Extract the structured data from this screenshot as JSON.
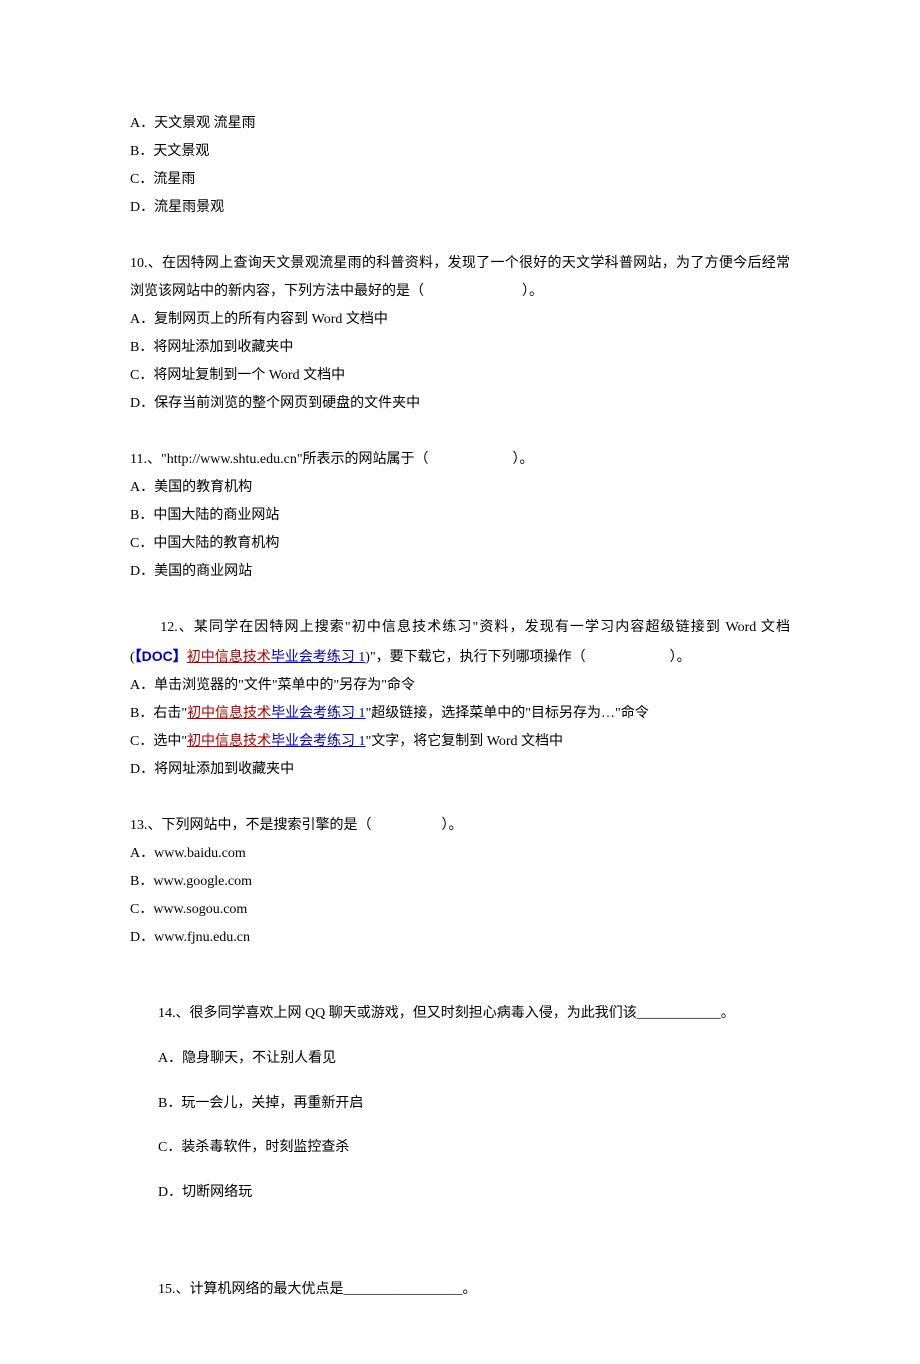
{
  "q9": {
    "optA": "A．天文景观  流星雨",
    "optB": "B．天文景观",
    "optC": "C．流星雨",
    "optD": "D．流星雨景观"
  },
  "q10": {
    "stem": "10.、在因特网上查询天文景观流星雨的科普资料，发现了一个很好的天文学科普网站，为了方便今后经常浏览该网站中的新内容，下列方法中最好的是（　　　　　　　）。",
    "optA": "A．复制网页上的所有内容到 Word 文档中",
    "optB": "B．将网址添加到收藏夹中",
    "optC": "C．将网址复制到一个 Word 文档中",
    "optD": "D．保存当前浏览的整个网页到硬盘的文件夹中"
  },
  "q11": {
    "stem": "11.、\"http://www.shtu.edu.cn\"所表示的网站属于（　　　　　　）。",
    "optA": "A．美国的教育机构",
    "optB": "B．中国大陆的商业网站",
    "optC": "C．中国大陆的教育机构",
    "optD": "D．美国的商业网站"
  },
  "q12": {
    "stem_prefix": "　　12.、某同学在因特网上搜索\"初中信息技术练习\"资料，发现有一学习内容超级链接到 Word 文档(",
    "doc_tag_open": "【",
    "doc_tag_text": "DOC",
    "doc_tag_close": "】",
    "link1_red": "初中信息技术",
    "link1_blue": "毕业会考练习 1",
    "stem_suffix": ")\"，要下载它，执行下列哪项操作（　　　　　　）。",
    "optA": "A．单击浏览器的\"文件\"菜单中的\"另存为\"命令",
    "optB_prefix": "B．右击\"",
    "optB_red": "初中信息技术",
    "optB_blue": "毕业会考练习 1",
    "optB_suffix": "\"超级链接，选择菜单中的\"目标另存为…\"命令",
    "optC_prefix": "C．选中\"",
    "optC_red": "初中信息技术",
    "optC_blue": "毕业会考练习 1",
    "optC_suffix": "\"文字，将它复制到 Word 文档中",
    "optD": "D．将网址添加到收藏夹中"
  },
  "q13": {
    "stem": "13.、下列网站中，不是搜索引擎的是（　　　　　）。",
    "optA": "A．www.baidu.com",
    "optB": "B．www.google.com",
    "optC": "C．www.sogou.com",
    "optD": "D．www.fjnu.edu.cn"
  },
  "q14": {
    "stem": "　　14.、很多同学喜欢上网 QQ 聊天或游戏，但又时刻担心病毒入侵，为此我们该____________。",
    "optA": "　　A．隐身聊天，不让别人看见",
    "optB": "　　B．玩一会儿，关掉，再重新开启",
    "optC": "　　C．装杀毒软件，时刻监控查杀",
    "optD": "　　D．切断网络玩"
  },
  "q15": {
    "stem": "　　15.、计算机网络的最大优点是_________________。"
  }
}
